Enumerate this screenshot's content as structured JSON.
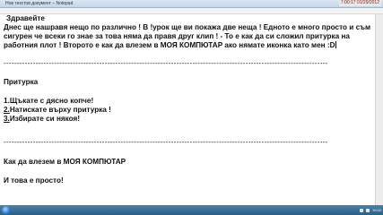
{
  "window": {
    "title": "Нов текстов документ – Notepad",
    "clock": "7:00:17  01/29/2012"
  },
  "menu": [
    "Файл",
    "Редактиране",
    "Формат",
    "Изглед",
    "Помощ"
  ],
  "content": {
    "greeting": "Здравейте",
    "line1": "Днес ще нашравя нещо по различно ! В !урок ще ви покажа две неща ! Едното е много просто и съм",
    "line2": "сигурен че всеки го знае за това няма да правя друг клип ! - То е как да си сложил притурка на",
    "line3": "работния плот ! Второто е как да влезем в МОЯ КОМПЮТАР ако нямате иконка като мен :D",
    "dashes1": "--------------------------------------------------------------------------------------------------------------------------",
    "section1_title": "Притурка",
    "step1": "1.Щъкате с дясно копче!",
    "step2_num": "2.",
    "step2_text": "Натискате върху притурка !",
    "step3_num": "3.",
    "step3_text": "Избирате си някоя!",
    "dashes2": "--------------------------------------------------------------------------------------------------------------------------",
    "section2_title": "Как да влезем в МОЯ КОМПЮТАР",
    "closing": "И това е просто!"
  },
  "taskbar": {
    "time": "19:02"
  }
}
